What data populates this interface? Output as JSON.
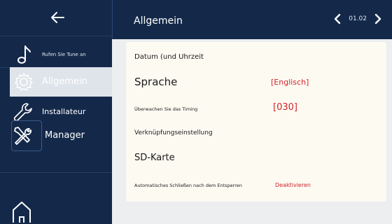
{
  "header": {
    "title": "Allgemein",
    "page": "01.02"
  },
  "sidebar": {
    "items": [
      {
        "label": "Rufen Sie Tune an",
        "icon": "music-note-icon"
      },
      {
        "label": "Allgemein",
        "icon": "gear-icon",
        "selected": true
      },
      {
        "label": "Installateur",
        "icon": "wrench-icon"
      },
      {
        "label": "Manager",
        "icon": "tools-icon"
      }
    ],
    "back_icon": "arrow-left-icon",
    "home_icon": "home-icon"
  },
  "settings": {
    "datetime_label": "Datum (und Uhrzeit",
    "language_label": "Sprache",
    "language_value": "[Englisch]",
    "timing_label": "Überwachen Sie das Timing",
    "timing_value": "[030]",
    "link_label": "Verknüpfungseinstellung",
    "sd_label": "SD-Karte",
    "autoclose_label": "Automatisches Schließen nach dem Entsperren",
    "autoclose_value": "Deaktivieren"
  },
  "colors": {
    "background": "#14294a",
    "accent_value": "#d2232a",
    "card": "#fdfaf2"
  }
}
